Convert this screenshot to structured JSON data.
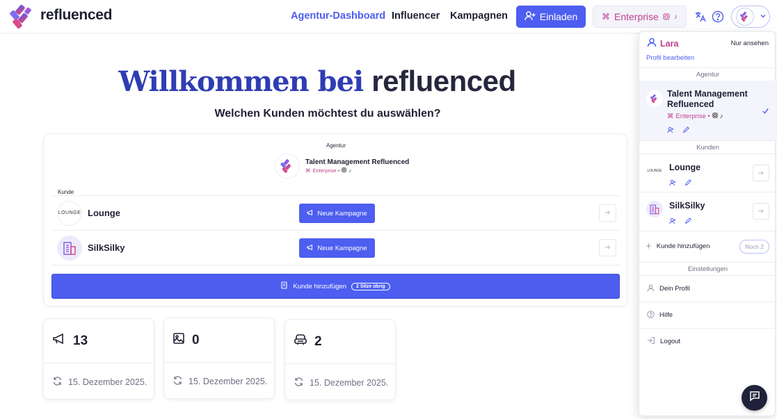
{
  "brand": {
    "name": "refluenced"
  },
  "colors": {
    "accent": "#4d5ef0",
    "brand_pink": "#c0418f",
    "dark": "#1f2033"
  },
  "nav": {
    "dashboard": "Agentur-Dashboard",
    "influencer": "Influencer",
    "campaigns": "Kampagnen"
  },
  "header": {
    "invite_label": "Einladen",
    "plan_label": "Enterprise"
  },
  "hero": {
    "welcome": "Willkommen bei",
    "brand": "refluenced"
  },
  "subtitle": "Welchen Kunden möchtest du auswählen?",
  "selector": {
    "agency_caption": "Agentur",
    "agency_name": "Talent Management Refluenced",
    "agency_plan": "Enterprise •",
    "client_caption": "Kunde",
    "clients": [
      {
        "name": "Lounge",
        "logo_text": "LOUNGE",
        "button": "Neue Kampagne"
      },
      {
        "name": "SilkSilky",
        "logo_text": "",
        "button": "Neue Kampagne"
      }
    ],
    "add_client_label": "Kunde hinzufügen",
    "seats_label": "2 Sitze übrig"
  },
  "stats": [
    {
      "value": "13",
      "date": "15. Dezember 2025.",
      "icon": "megaphone-icon"
    },
    {
      "value": "0",
      "date": "15. Dezember 2025.",
      "icon": "image-icon"
    },
    {
      "value": "2",
      "date": "15. Dezember 2025.",
      "icon": "armchair-icon"
    }
  ],
  "panel": {
    "user_name": "Lara",
    "view_only": "Nur ansehen",
    "edit_profile": "Profil bearbeiten",
    "section_agency": "Agentur",
    "agency_name": "Talent Management Refluenced",
    "agency_plan": "Enterprise •",
    "section_clients": "Kunden",
    "clients": [
      {
        "name": "Lounge",
        "logo_text": "LOUNGE"
      },
      {
        "name": "SilkSilky",
        "logo_text": ""
      }
    ],
    "add_client": "Kunde hinzufügen",
    "remaining": "Noch 2",
    "section_settings": "Einstellungen",
    "menu": {
      "profile": "Dein Profil",
      "help": "Hilfe",
      "logout": "Logout"
    }
  }
}
